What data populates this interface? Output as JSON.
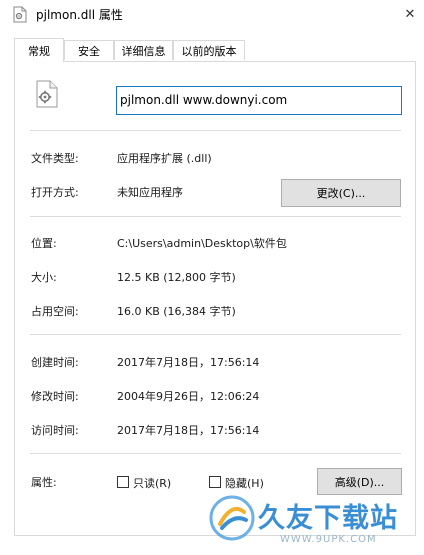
{
  "window": {
    "title": "pjlmon.dll 属性",
    "close_glyph": "✕"
  },
  "tabs": [
    {
      "label": "常规",
      "active": true
    },
    {
      "label": "安全",
      "active": false
    },
    {
      "label": "详细信息",
      "active": false
    },
    {
      "label": "以前的版本",
      "active": false
    }
  ],
  "file": {
    "icon": "dll-file-icon",
    "name_value": "pjlmon.dll www.downyi.com"
  },
  "type_section": {
    "file_type_label": "文件类型:",
    "file_type_value": "应用程序扩展 (.dll)",
    "open_with_label": "打开方式:",
    "open_with_value": "未知应用程序",
    "change_button": "更改(C)..."
  },
  "location_section": {
    "location_label": "位置:",
    "location_value": "C:\\Users\\admin\\Desktop\\软件包",
    "size_label": "大小:",
    "size_value": "12.5 KB (12,800 字节)",
    "disk_size_label": "占用空间:",
    "disk_size_value": "16.0 KB (16,384 字节)"
  },
  "time_section": {
    "created_label": "创建时间:",
    "created_value": "2017年7月18日，17:56:14",
    "modified_label": "修改时间:",
    "modified_value": "2004年9月26日，12:06:24",
    "accessed_label": "访问时间:",
    "accessed_value": "2017年7月18日，17:56:14"
  },
  "attributes": {
    "label": "属性:",
    "readonly_label": "只读(R)",
    "readonly_checked": false,
    "hidden_label": "隐藏(H)",
    "hidden_checked": false,
    "advanced_button": "高级(D)..."
  },
  "watermark": {
    "text": "久友下载站",
    "sub": "WWW.9UPK.COM"
  }
}
